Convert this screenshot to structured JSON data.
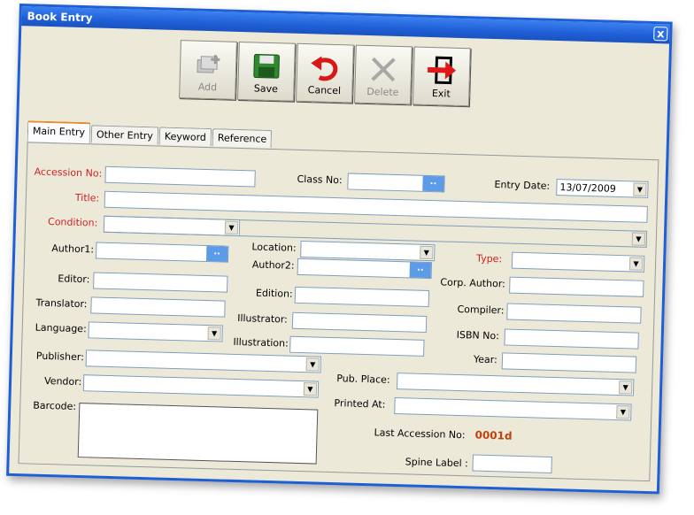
{
  "window": {
    "title": "Book Entry",
    "close_label": "x"
  },
  "toolbar": {
    "add": "Add",
    "save": "Save",
    "cancel": "Cancel",
    "delete": "Delete",
    "exit": "Exit"
  },
  "tabs": [
    "Main Entry",
    "Other Entry",
    "Keyword",
    "Reference"
  ],
  "form": {
    "accession_no": "Accession No:",
    "class_no": "Class No:",
    "entry_date": "Entry Date:",
    "entry_date_value": "13/07/2009",
    "title": "Title:",
    "condition": "Condition:",
    "location": "Location:",
    "type": "Type:",
    "author1": "Author1:",
    "author2": "Author2:",
    "corp_author": "Corp. Author:",
    "editor": "Editor:",
    "edition": "Edition:",
    "compiler": "Compiler:",
    "translator": "Translator:",
    "illustrator": "Illustrator:",
    "isbn": "ISBN No:",
    "language": "Language:",
    "illustration": "Illustration:",
    "year": "Year:",
    "publisher": "Publisher:",
    "pub_place": "Pub. Place:",
    "vendor": "Vendor:",
    "printed_at": "Printed At:",
    "barcode": "Barcode:",
    "last_accession": "Last Accession No:",
    "last_accession_value": "0001d",
    "spine_label": "Spine Label :",
    "lookup_button": ".."
  },
  "colors": {
    "required_label": "#cc2222",
    "title_bar": "#1f5fd6",
    "panel": "#ece9d8"
  }
}
